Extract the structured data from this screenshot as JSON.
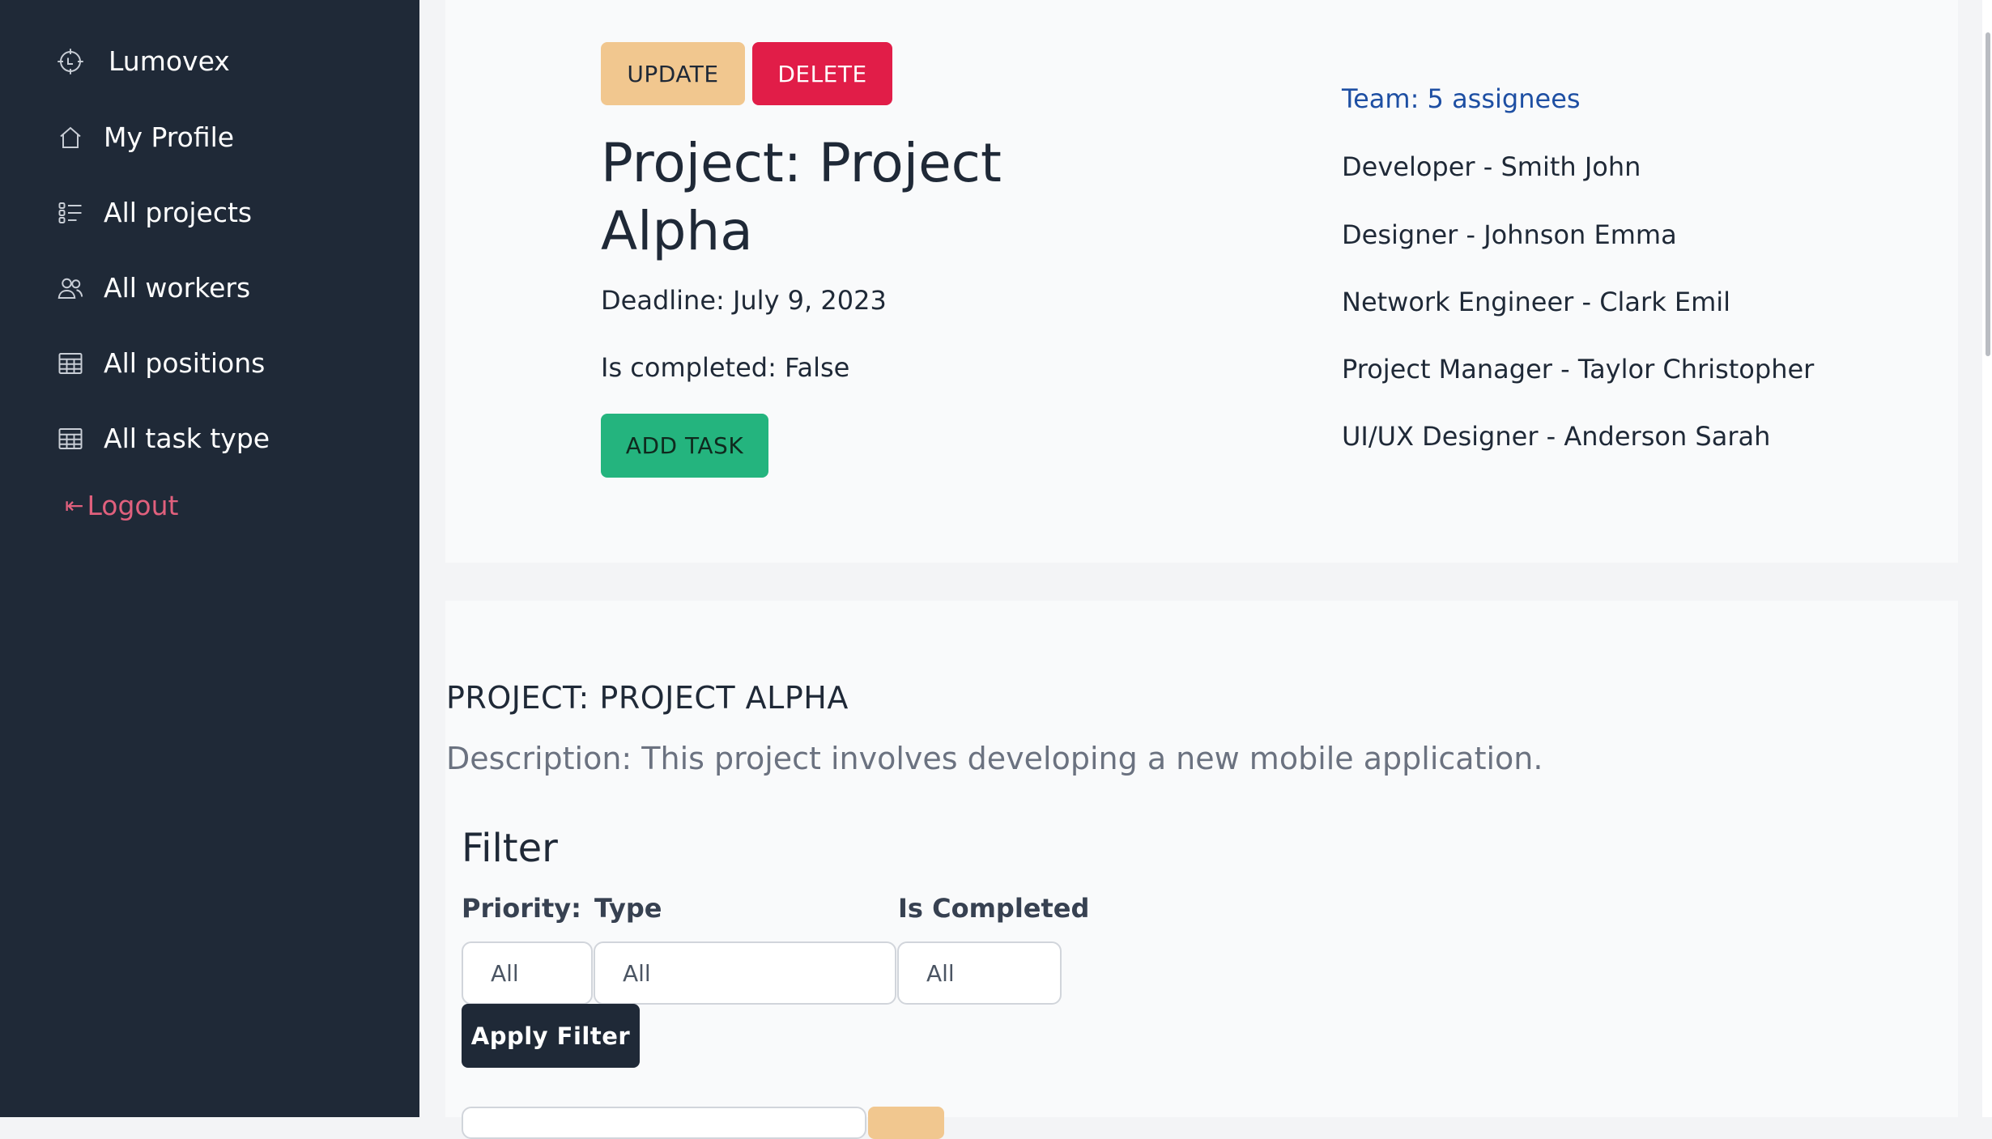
{
  "sidebar": {
    "brand": "Lumovex",
    "items": [
      {
        "label": "My Profile",
        "icon": "home-icon"
      },
      {
        "label": "All projects",
        "icon": "list-icon"
      },
      {
        "label": "All workers",
        "icon": "users-icon"
      },
      {
        "label": "All positions",
        "icon": "table-icon"
      },
      {
        "label": "All task type",
        "icon": "table-icon"
      }
    ],
    "logout": "Logout"
  },
  "project": {
    "update_label": "UPDATE",
    "delete_label": "DELETE",
    "title": "Project: Project Alpha",
    "deadline": "Deadline: July 9, 2023",
    "completed": "Is completed: False",
    "add_task_label": "ADD TASK"
  },
  "team": {
    "title": "Team: 5 assignees",
    "members": [
      "Developer - Smith John",
      "Designer - Johnson Emma",
      "Network Engineer - Clark Emil",
      "Project Manager - Taylor Christopher",
      "UI/UX Designer - Anderson Sarah"
    ]
  },
  "details": {
    "heading": "PROJECT: PROJECT ALPHA",
    "description": "Description: This project involves developing a new mobile application."
  },
  "filter": {
    "title": "Filter",
    "priority_label": "Priority:",
    "type_label": "Type",
    "completed_label": "Is Completed",
    "priority_value": "All",
    "type_value": "All",
    "completed_value": "All",
    "apply_label": "Apply Filter"
  },
  "colors": {
    "sidebar_bg": "#1f2937",
    "update": "#f1c78f",
    "delete": "#e11d48",
    "add_task": "#24b47e",
    "team_link": "#1e4fa3",
    "logout": "#e0607d"
  }
}
